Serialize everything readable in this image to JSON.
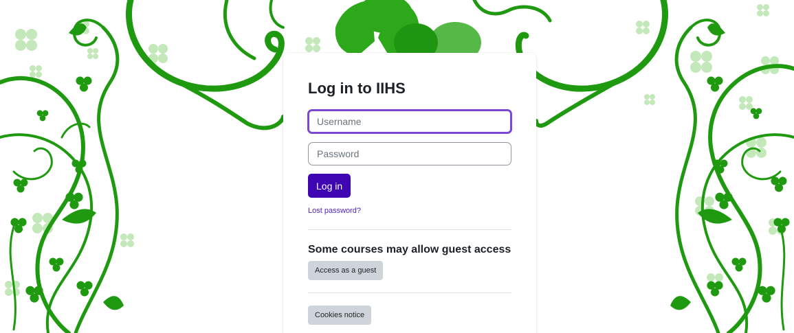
{
  "login": {
    "title": "Log in to IIHS",
    "username_placeholder": "Username",
    "password_placeholder": "Password",
    "submit_label": "Log in",
    "lost_password_link": "Lost password?"
  },
  "guest": {
    "heading": "Some courses may allow guest access",
    "button_label": "Access as a guest"
  },
  "footer": {
    "cookies_label": "Cookies notice"
  },
  "colors": {
    "primary": "#3f05b3",
    "focus_ring": "#7b47d3",
    "link": "#4c1db4",
    "secondary_button": "#ced4da",
    "vine_green": "#1f9a10",
    "clover_light": "#a9dd9a"
  },
  "decoration": {
    "background_theme": "green swirling vines with shamrocks",
    "icons": [
      "shamrock-icon",
      "vine-swirl"
    ]
  }
}
